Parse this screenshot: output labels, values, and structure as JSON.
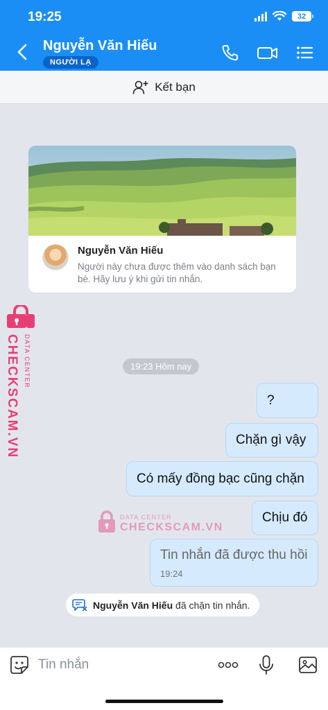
{
  "status": {
    "time": "19:25",
    "battery": "32"
  },
  "header": {
    "name": "Nguyễn Văn Hiếu",
    "badge": "NGƯỜI LẠ"
  },
  "add_friend": {
    "label": "Kết bạn"
  },
  "profile_card": {
    "name": "Nguyễn Văn Hiếu",
    "description": "Người này chưa được thêm vào danh sách bạn bè. Hãy lưu ý khi gửi tin nhắn."
  },
  "watermark": {
    "brand": "CHECKSCAM.VN",
    "tagline": "DATA CENTER"
  },
  "time_divider": "19:23 Hôm nay",
  "messages": [
    {
      "text": "?"
    },
    {
      "text": "Chặn gì vậy"
    },
    {
      "text": "Có mấy đồng bạc cũng chặn"
    },
    {
      "text": "Chịu đó"
    },
    {
      "text": "Tin nhắn đã được thu hồi",
      "time": "19:24"
    }
  ],
  "block_notice": {
    "name": "Nguyễn Văn Hiếu",
    "text": "đã chặn tin nhắn."
  },
  "composer": {
    "placeholder": "Tin nhắn"
  },
  "colors": {
    "header": "#1b8ef6",
    "bubble": "#d5eafd",
    "watermark": "#e83e76"
  }
}
